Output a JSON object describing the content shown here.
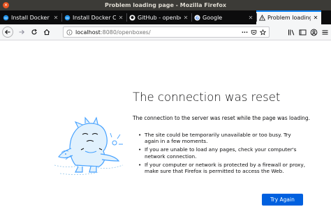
{
  "window": {
    "title": "Problem loading page - Mozilla Firefox"
  },
  "tabs": [
    {
      "label": "Install Docker En",
      "icon": "docker-docs-icon",
      "active": false
    },
    {
      "label": "Install Docker Co",
      "icon": "docker-docs-icon",
      "active": false
    },
    {
      "label": "GitHub - openbo",
      "icon": "github-icon",
      "active": false
    },
    {
      "label": "Google",
      "icon": "google-icon",
      "active": false
    },
    {
      "label": "Problem loading",
      "icon": "warning-icon",
      "active": true
    }
  ],
  "navbar": {
    "url_host": "localhost",
    "url_rest": ":8080/openboxes/"
  },
  "error": {
    "title": "The connection was reset",
    "description": "The connection to the server was reset while the page was loading.",
    "items": [
      "The site could be temporarily unavailable or too busy. Try again in a few moments.",
      "If you are unable to load any pages, check your computer's network connection.",
      "If your computer or network is protected by a firewall or proxy, make sure that Firefox is permitted to access the Web."
    ],
    "button_label": "Try Again"
  },
  "colors": {
    "accent": "#0060df",
    "tab_highlight": "#0a84ff",
    "titlebar": "#3c3b37",
    "close_button": "#e95420"
  }
}
